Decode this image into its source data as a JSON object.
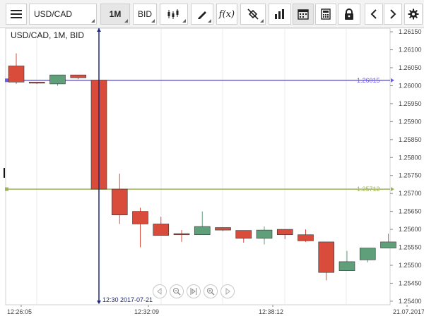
{
  "toolbar": {
    "symbol": "USD/CAD",
    "timeframe": "1M",
    "price_side": "BID",
    "icons": [
      "menu-icon",
      "candlestick-icon",
      "pencil-icon",
      "fx-icon",
      "eraser-icon",
      "bar-chart-icon",
      "calendar-icon",
      "calculator-icon",
      "lock-icon",
      "chevron-left-icon",
      "chevron-right-icon",
      "gear-icon"
    ],
    "fx_label": "f(x)"
  },
  "chart": {
    "title": "USD/CAD, 1M, BID",
    "crosshair_label": "12:30 2017-07-21",
    "line_blue_label": "1.26015",
    "line_green_label": "1.25712"
  },
  "colors": {
    "bear": "#d94b3a",
    "bull": "#5fa07a",
    "blue_line": "#6b5df0",
    "green_line": "#9cb35a",
    "crosshair": "#1e2a7a"
  },
  "chart_data": {
    "type": "candlestick",
    "ylim": [
      1.2539,
      1.2616
    ],
    "y_ticks": [
      "1.26150",
      "1.26100",
      "1.26050",
      "1.26000",
      "1.25950",
      "1.25900",
      "1.25850",
      "1.25800",
      "1.25750",
      "1.25700",
      "1.25650",
      "1.25600",
      "1.25550",
      "1.25500",
      "1.25450",
      "1.25400"
    ],
    "x_ticks": [
      "12:26:05",
      "12:32:09",
      "12:38:12",
      "21.07.2017"
    ],
    "horizontal_lines": [
      1.26015,
      1.25712
    ],
    "candles": [
      {
        "open": 1.26055,
        "high": 1.2609,
        "low": 1.26005,
        "close": 1.2601
      },
      {
        "open": 1.2601,
        "high": 1.2601,
        "low": 1.26005,
        "close": 1.26007
      },
      {
        "open": 1.26005,
        "high": 1.2603,
        "low": 1.26,
        "close": 1.2603
      },
      {
        "open": 1.2603,
        "high": 1.2603,
        "low": 1.26018,
        "close": 1.26022
      },
      {
        "open": 1.26015,
        "high": 1.26015,
        "low": 1.25712,
        "close": 1.25712
      },
      {
        "open": 1.25712,
        "high": 1.25755,
        "low": 1.25615,
        "close": 1.2564
      },
      {
        "open": 1.2565,
        "high": 1.2566,
        "low": 1.2555,
        "close": 1.25615
      },
      {
        "open": 1.25615,
        "high": 1.25635,
        "low": 1.25583,
        "close": 1.25583
      },
      {
        "open": 1.25588,
        "high": 1.25598,
        "low": 1.25565,
        "close": 1.25585
      },
      {
        "open": 1.25585,
        "high": 1.2565,
        "low": 1.25585,
        "close": 1.25608
      },
      {
        "open": 1.25605,
        "high": 1.25605,
        "low": 1.25595,
        "close": 1.25598
      },
      {
        "open": 1.25597,
        "high": 1.25597,
        "low": 1.25563,
        "close": 1.25575
      },
      {
        "open": 1.25575,
        "high": 1.25608,
        "low": 1.25558,
        "close": 1.25598
      },
      {
        "open": 1.256,
        "high": 1.256,
        "low": 1.25573,
        "close": 1.25585
      },
      {
        "open": 1.25585,
        "high": 1.256,
        "low": 1.25565,
        "close": 1.25568
      },
      {
        "open": 1.25565,
        "high": 1.25565,
        "low": 1.25458,
        "close": 1.2548
      },
      {
        "open": 1.25485,
        "high": 1.2554,
        "low": 1.25485,
        "close": 1.2551
      },
      {
        "open": 1.25515,
        "high": 1.25548,
        "low": 1.25508,
        "close": 1.25548
      },
      {
        "open": 1.25548,
        "high": 1.25588,
        "low": 1.25548,
        "close": 1.25565
      }
    ]
  }
}
